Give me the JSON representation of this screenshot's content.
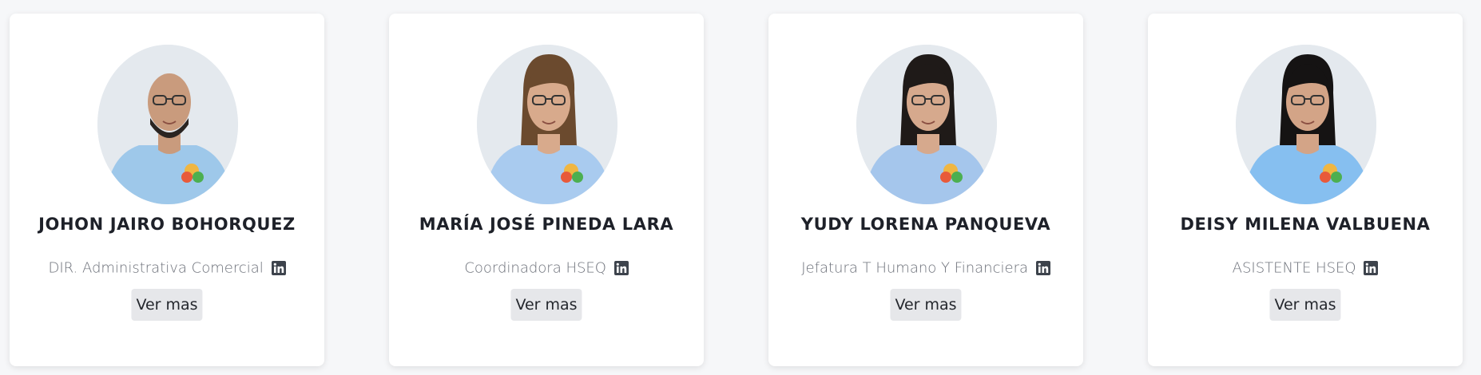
{
  "team": [
    {
      "name": "JOHON JAIRO BOHORQUEZ",
      "role": "DIR. Administrativa Comercial",
      "button": "Ver mas",
      "hair": "#2a2421",
      "skin": "#c99b7d",
      "shirt": "#9ec8ea"
    },
    {
      "name": "MARÍA JOSÉ PINEDA LARA",
      "role": "Coordinadora HSEQ",
      "button": "Ver mas",
      "hair": "#6b4a2e",
      "skin": "#d8aa8c",
      "shirt": "#a9cbef"
    },
    {
      "name": "YUDY LORENA PANQUEVA",
      "role": "Jefatura T Humano Y Financiera",
      "button": "Ver mas",
      "hair": "#1f1a18",
      "skin": "#d6a98d",
      "shirt": "#a5c6ec"
    },
    {
      "name": "DEISY MILENA VALBUENA",
      "role": "ASISTENTE HSEQ",
      "button": "Ver mas",
      "hair": "#151313",
      "skin": "#d3a487",
      "shirt": "#86bff0"
    }
  ],
  "icons": {
    "profile": "linkedin-icon",
    "photo": "avatar-photo"
  }
}
